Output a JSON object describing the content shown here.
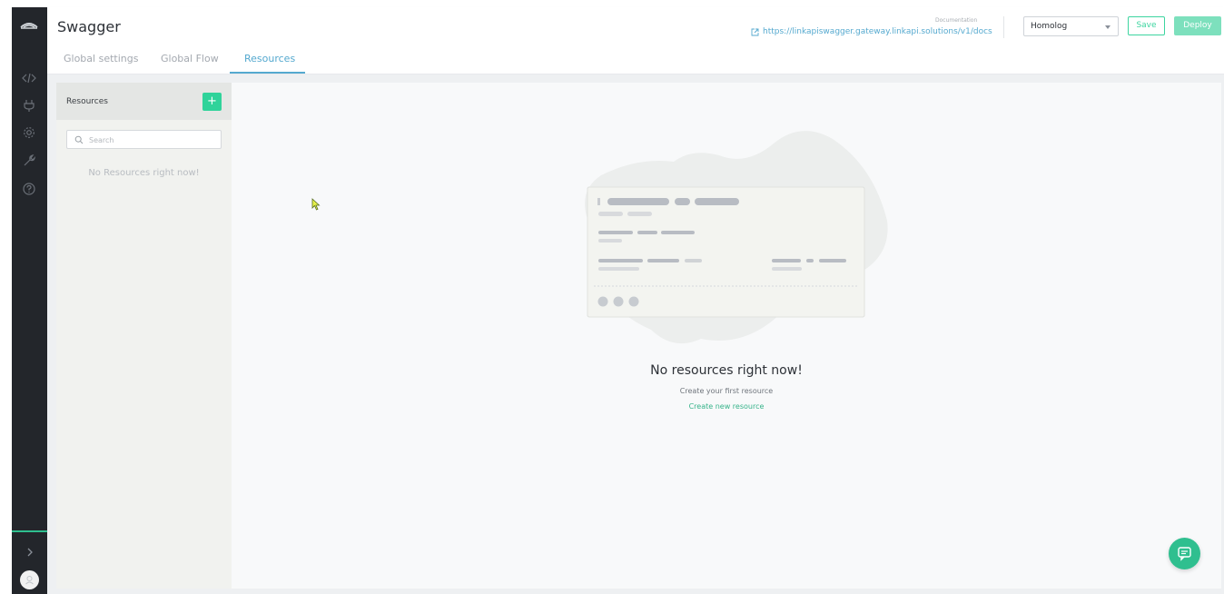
{
  "app": {
    "title": "Swagger"
  },
  "tabs": [
    {
      "label": "Global settings",
      "active": false
    },
    {
      "label": "Global Flow",
      "active": false
    },
    {
      "label": "Resources",
      "active": true
    }
  ],
  "documentation": {
    "label": "Documentation",
    "url": "https://linkapiswagger.gateway.linkapi.solutions/v1/docs"
  },
  "environment": {
    "selected": "Homolog"
  },
  "actions": {
    "save_label": "Save",
    "deploy_label": "Deploy"
  },
  "sidebar": {
    "title": "Resources",
    "add_label": "+",
    "search_placeholder": "Search",
    "empty_text": "No Resources right now!"
  },
  "empty_state": {
    "title": "No resources right now!",
    "subtitle": "Create your first resource",
    "link_label": "Create new resource"
  },
  "nav_icons": [
    "cloud-logo-icon",
    "code-icon",
    "plug-icon",
    "gear-icon",
    "wrench-icon",
    "help-icon",
    "chevron-right-icon",
    "user-avatar-icon"
  ],
  "colors": {
    "accent_green": "#2fd39a",
    "accent_blue": "#55a9cf",
    "rail_bg": "#23262b"
  }
}
